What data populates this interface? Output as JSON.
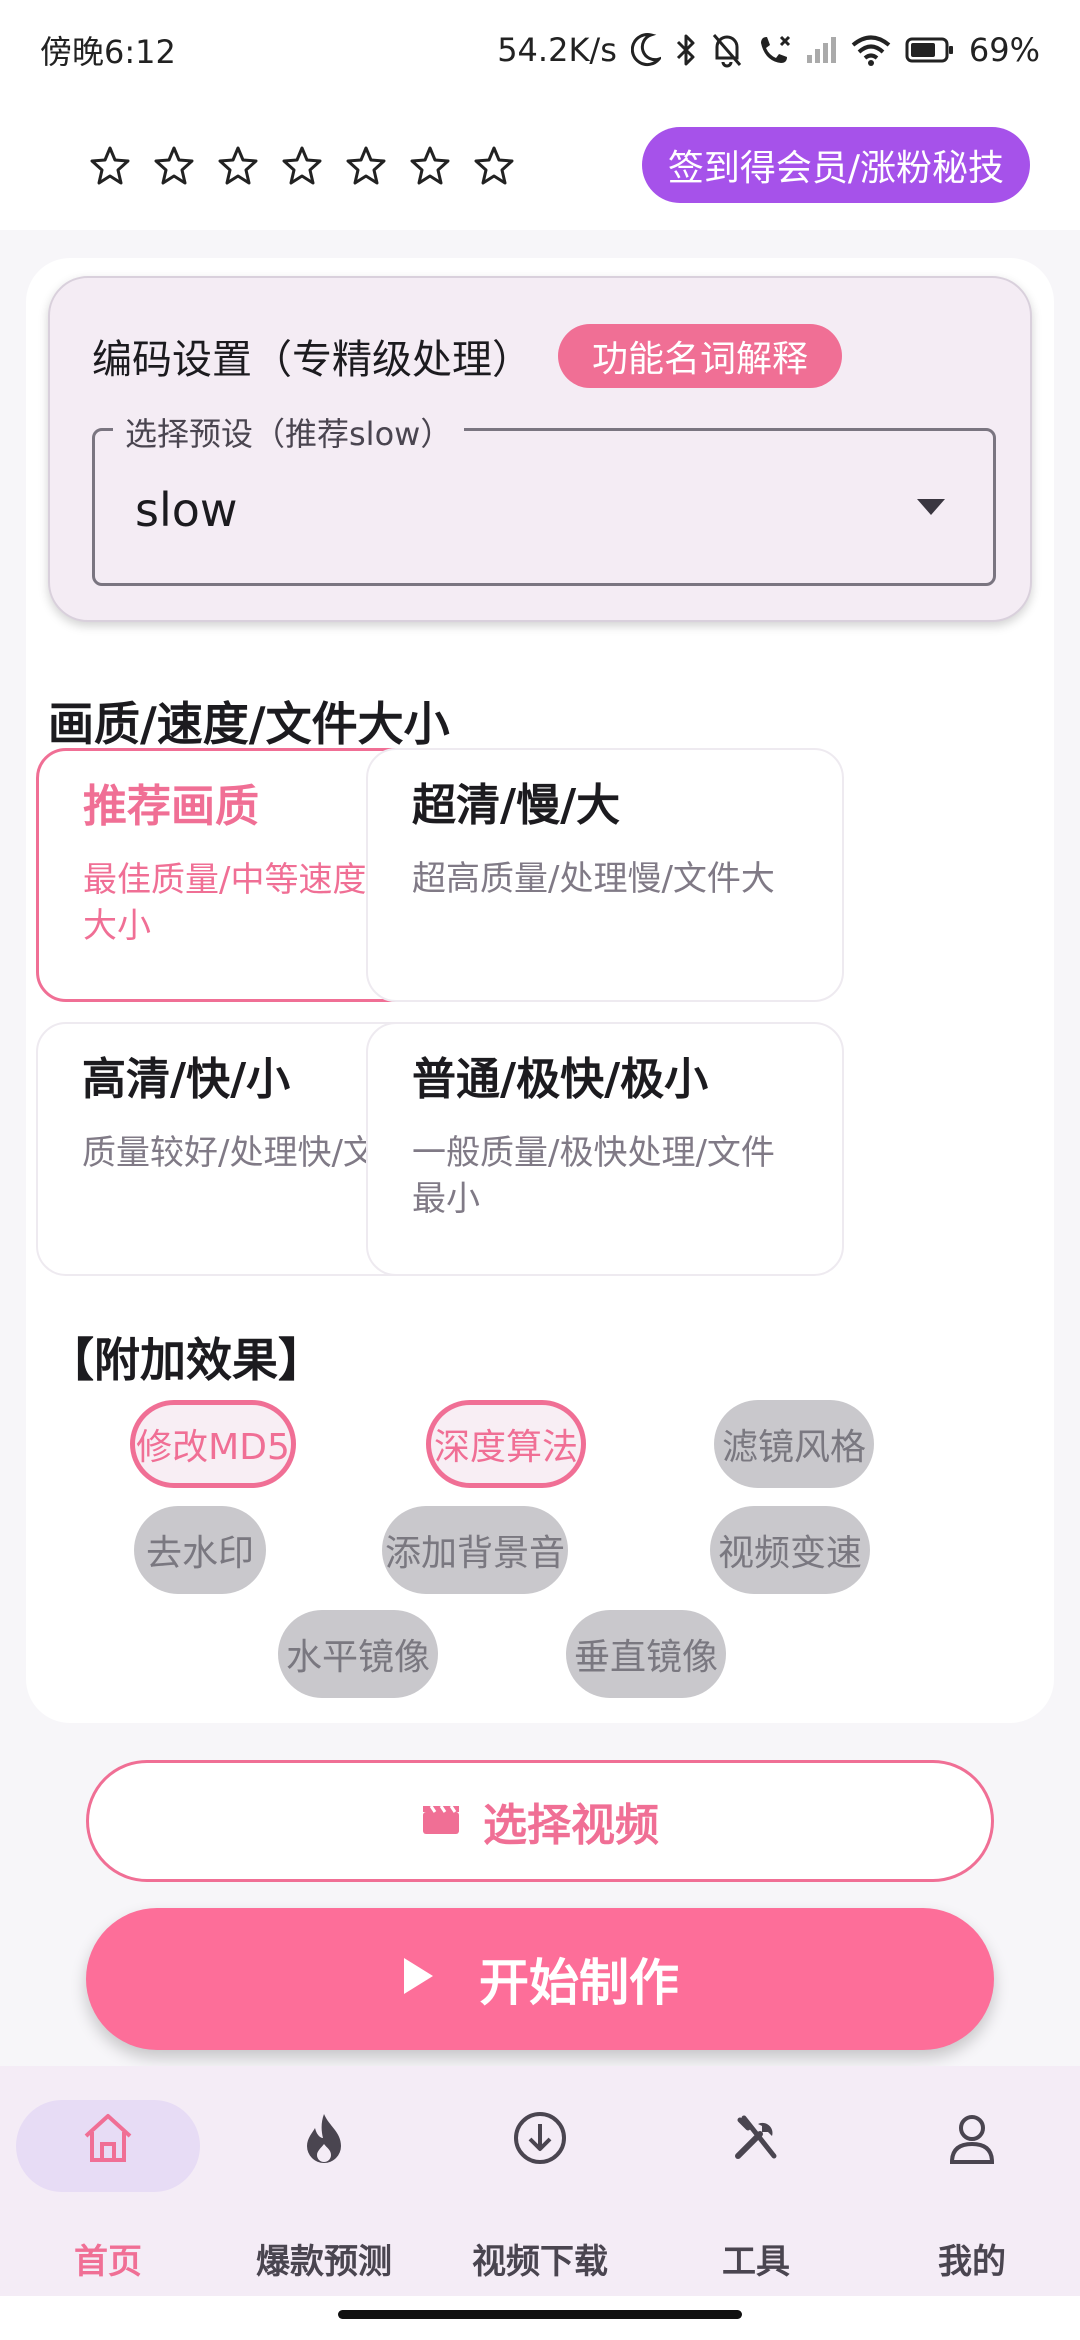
{
  "status_bar": {
    "time": "傍晚6:12",
    "net_speed": "54.2K/s",
    "battery": "69%",
    "icons": [
      "moon-icon",
      "bluetooth-icon",
      "bell-off-icon",
      "phone-missed-icon",
      "signal-icon",
      "wifi-icon",
      "battery-icon"
    ]
  },
  "header": {
    "star_count": 7,
    "promo_label": "签到得会员/涨粉秘技"
  },
  "encoding": {
    "title": "编码设置（专精级处理）",
    "explain_label": "功能名词解释",
    "preset_legend": "选择预设（推荐slow）",
    "preset_value": "slow"
  },
  "quality_section": {
    "title": "画质/速度/文件大小",
    "options": [
      {
        "title": "推荐画质",
        "desc": "最佳质量/中等速度/中等大小",
        "selected": true
      },
      {
        "title": "超清/慢/大",
        "desc": "超高质量/处理慢/文件大",
        "selected": false
      },
      {
        "title": "高清/快/小",
        "desc": "质量较好/处理快/文件小",
        "selected": false
      },
      {
        "title": "普通/极快/极小",
        "desc": "一般质量/极快处理/文件最小",
        "selected": false
      }
    ]
  },
  "effects_section": {
    "title": "【附加效果】",
    "chips": [
      {
        "label": "修改MD5",
        "on": true
      },
      {
        "label": "深度算法",
        "on": true
      },
      {
        "label": "滤镜风格",
        "on": false
      },
      {
        "label": "去水印",
        "on": false
      },
      {
        "label": "添加背景音",
        "on": false
      },
      {
        "label": "视频变速",
        "on": false
      },
      {
        "label": "水平镜像",
        "on": false
      },
      {
        "label": "垂直镜像",
        "on": false
      }
    ]
  },
  "actions": {
    "select_video": "选择视频",
    "start": "开始制作"
  },
  "bottom_nav": {
    "items": [
      {
        "label": "首页",
        "icon": "home-icon",
        "active": true
      },
      {
        "label": "爆款预测",
        "icon": "fire-icon",
        "active": false
      },
      {
        "label": "视频下载",
        "icon": "download-icon",
        "active": false
      },
      {
        "label": "工具",
        "icon": "tools-icon",
        "active": false
      },
      {
        "label": "我的",
        "icon": "person-icon",
        "active": false
      }
    ]
  },
  "colors": {
    "accent_pink": "#f06f95",
    "promo_purple": "#a652ea",
    "start_button": "#fd6e99"
  }
}
